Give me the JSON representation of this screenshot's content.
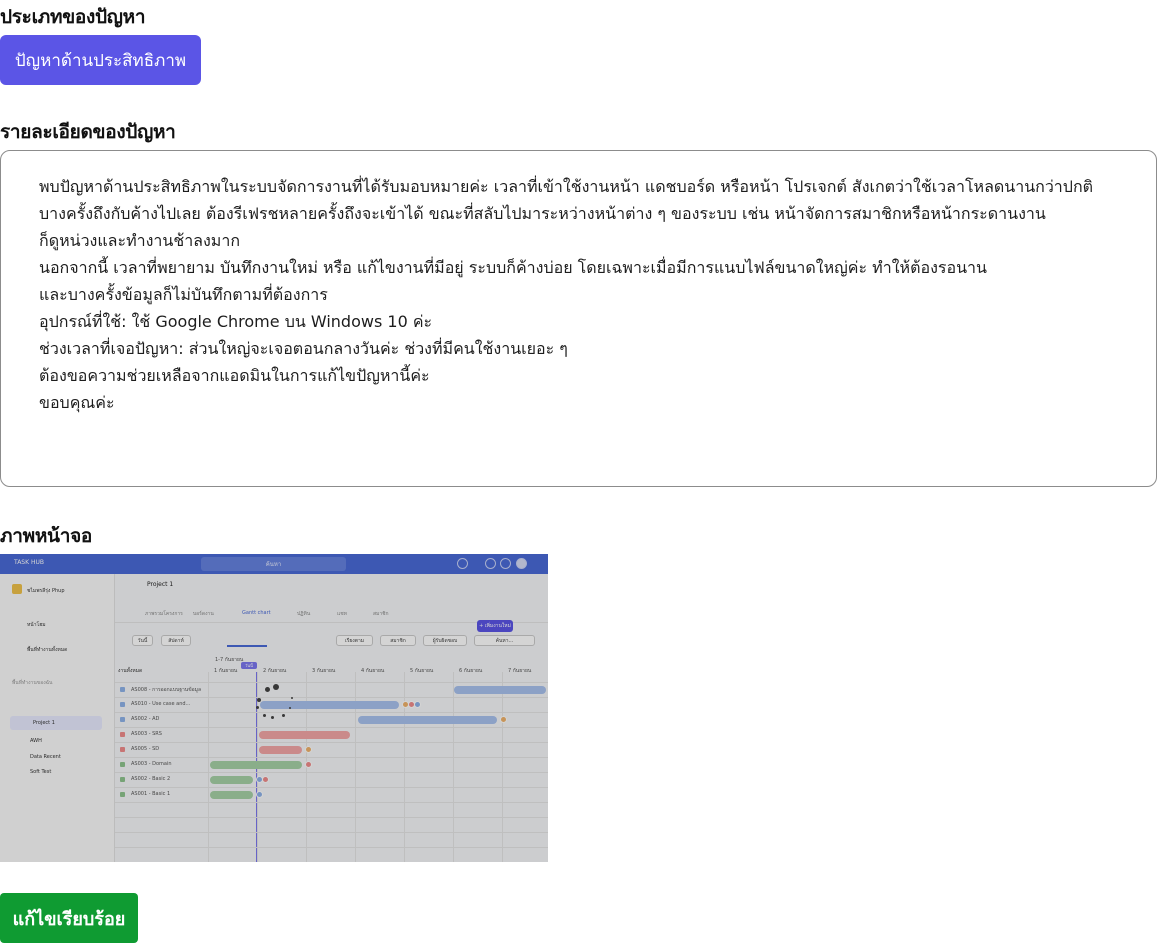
{
  "issue_type": {
    "title": "ประเภทของปัญหา",
    "selected_label": "ปัญหาด้านประสิทธิภาพ"
  },
  "details": {
    "title": "รายละเอียดของปัญหา",
    "lines": [
      "พบปัญหาด้านประสิทธิภาพในระบบจัดการงานที่ได้รับมอบหมายค่ะ เวลาที่เข้าใช้งานหน้า แดชบอร์ด หรือหน้า โปรเจกต์ สังเกตว่าใช้เวลาโหลดนานกว่าปกติ",
      "บางครั้งถึงกับค้างไปเลย ต้องรีเฟรชหลายครั้งถึงจะเข้าได้ ขณะที่สลับไปมาระหว่างหน้าต่าง ๆ ของระบบ เช่น หน้าจัดการสมาชิกหรือหน้ากระดานงาน",
      "ก็ดูหน่วงและทำงานช้าลงมาก",
      "นอกจากนี้ เวลาที่พยายาม บันทึกงานใหม่ หรือ แก้ไขงานที่มีอยู่ ระบบก็ค้างบ่อย โดยเฉพาะเมื่อมีการแนบไฟล์ขนาดใหญ่ค่ะ ทำให้ต้องรอนาน",
      "และบางครั้งข้อมูลก็ไม่บันทึกตามที่ต้องการ",
      "อุปกรณ์ที่ใช้: ใช้ Google Chrome บน Windows 10 ค่ะ",
      "ช่วงเวลาที่เจอปัญหา: ส่วนใหญ่จะเจอตอนกลางวันค่ะ ช่วงที่มีคนใช้งานเยอะ ๆ",
      "ต้องขอความช่วยเหลือจากแอดมินในการแก้ไขปัญหานี้ค่ะ",
      "ขอบคุณค่ะ"
    ]
  },
  "screenshot": {
    "title": "ภาพหน้าจอ",
    "app": {
      "logo": "TASK HUB",
      "search_placeholder": "ค้นหา",
      "user_name": "ชไมพรลีรุ่ง Phup",
      "sidebar": [
        "หน้าโฮม",
        "พื้นที่ทำงานทั้งหมด",
        "พื้นที่ทำงานของฉัน",
        "Project 1",
        "AWH",
        "Data Recent",
        "Soft Test"
      ],
      "project_title": "Project 1",
      "tabs": [
        "ภาพรวมโครงการ",
        "บอร์ดงาน",
        "Gantt chart",
        "ปฏิทิน",
        "แชท",
        "สมาชิก"
      ],
      "active_tab": "Gantt chart",
      "add_button": "+ เพิ่มงานใหม่",
      "filters": [
        "วันนี้",
        "สัปดาห์",
        "เรียงตาม",
        "สมาชิก",
        "ผู้รับผิดชอบ",
        "ค้นหา..."
      ],
      "month_label": "1-7 กันยายน",
      "today_label": "วันนี้",
      "task_column": "งานทั้งหมด",
      "days": [
        "1 กันยายน",
        "2 กันยายน",
        "3 กันยายน",
        "4 กันยายน",
        "5 กันยายน",
        "6 กันยายน",
        "7 กันยายน"
      ],
      "tasks": [
        "AS008 - การออกแบบฐานข้อมูล",
        "AS010 - Use case and...",
        "AS002 - AD",
        "AS003 - SRS",
        "AS005 - SD",
        "AS003 - Domain",
        "AS002 - Basic 2",
        "AS001 - Basic 1"
      ],
      "task_colors": [
        "#8fb3e8",
        "#8fb3e8",
        "#8fb3e8",
        "#f08c8c",
        "#f08c8c",
        "#8fc48f",
        "#8fc48f",
        "#8fc48f"
      ],
      "colors": {
        "blue_bar": "#a9c2ee",
        "red_bar": "#f3a7a7",
        "green_bar": "#a6d2a6",
        "accent": "#5b55e6"
      }
    }
  },
  "resolve_button": {
    "label": "แก้ไขเรียบร้อย"
  },
  "colors": {
    "type_button": "#5b55e6",
    "resolve_button": "#0f9b32",
    "box_border": "#8c8c8c"
  }
}
